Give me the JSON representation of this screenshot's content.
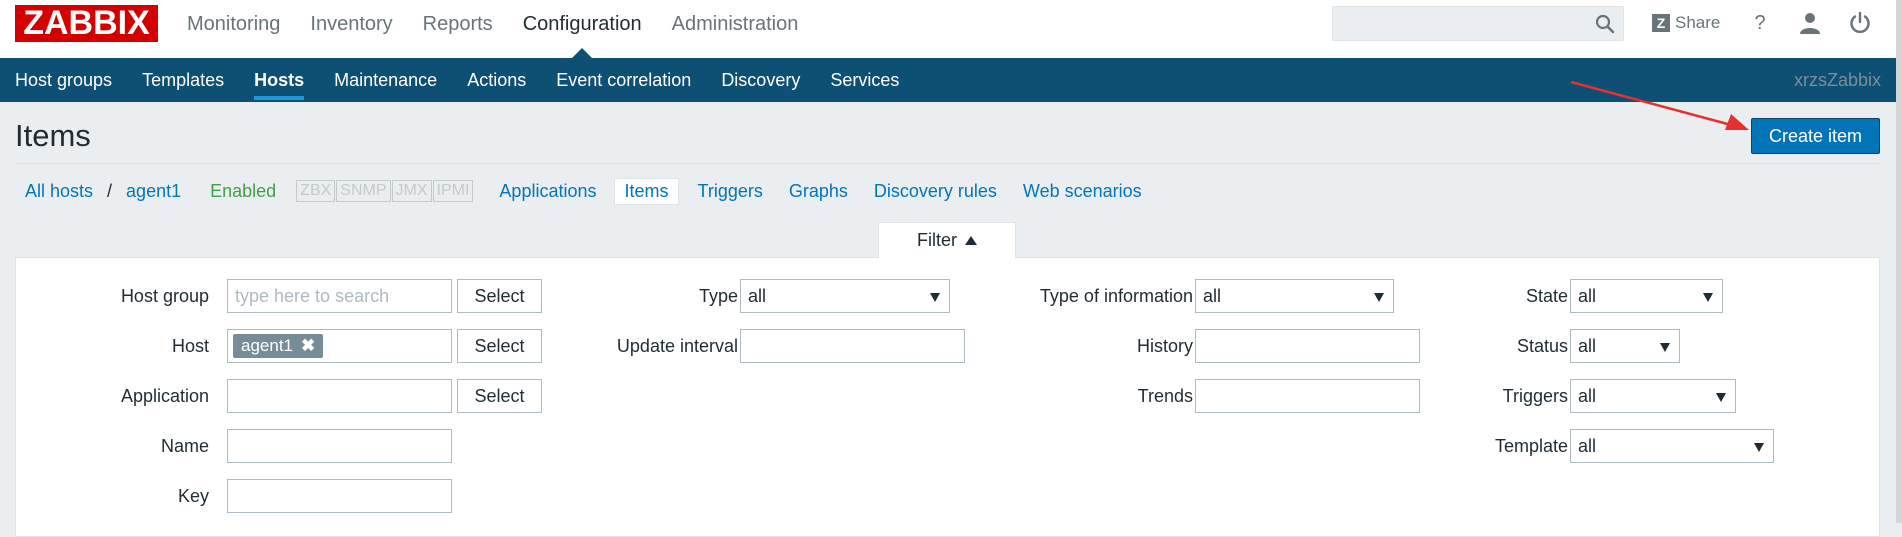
{
  "logo": "ZABBIX",
  "main_nav": [
    "Monitoring",
    "Inventory",
    "Reports",
    "Configuration",
    "Administration"
  ],
  "header": {
    "search_placeholder": "",
    "share_label": "Share",
    "help_label": "?",
    "icons": [
      "search-icon",
      "user-icon",
      "power-icon"
    ]
  },
  "sub_nav": {
    "items": [
      "Host groups",
      "Templates",
      "Hosts",
      "Maintenance",
      "Actions",
      "Event correlation",
      "Discovery",
      "Services"
    ],
    "selected": "Hosts",
    "server_name": "xrzsZabbix"
  },
  "page": {
    "title": "Items",
    "create_button": "Create item"
  },
  "host_nav": {
    "all_hosts": "All hosts",
    "separator": "/",
    "host": "agent1",
    "status": "Enabled",
    "availability": [
      "ZBX",
      "SNMP",
      "JMX",
      "IPMI"
    ],
    "tabs": [
      "Applications",
      "Items",
      "Triggers",
      "Graphs",
      "Discovery rules",
      "Web scenarios"
    ],
    "active_tab": "Items"
  },
  "filter": {
    "tab_label": "Filter",
    "select_label": "Select",
    "host_group": {
      "label": "Host group",
      "placeholder": "type here to search"
    },
    "host": {
      "label": "Host",
      "chip": "agent1"
    },
    "application": {
      "label": "Application",
      "value": ""
    },
    "name": {
      "label": "Name",
      "value": ""
    },
    "key": {
      "label": "Key",
      "value": ""
    },
    "type": {
      "label": "Type",
      "value": "all"
    },
    "update_interval": {
      "label": "Update interval",
      "value": ""
    },
    "type_of_information": {
      "label": "Type of information",
      "value": "all"
    },
    "history": {
      "label": "History",
      "value": ""
    },
    "trends": {
      "label": "Trends",
      "value": ""
    },
    "state": {
      "label": "State",
      "value": "all"
    },
    "status": {
      "label": "Status",
      "value": "all"
    },
    "triggers": {
      "label": "Triggers",
      "value": "all"
    },
    "template": {
      "label": "Template",
      "value": "all"
    }
  },
  "colors": {
    "brand_red": "#d40000",
    "subnav_bg": "#0e4f74",
    "primary_button": "#0275b8",
    "enabled_green": "#429e47",
    "annotation_arrow": "#e8312f"
  }
}
